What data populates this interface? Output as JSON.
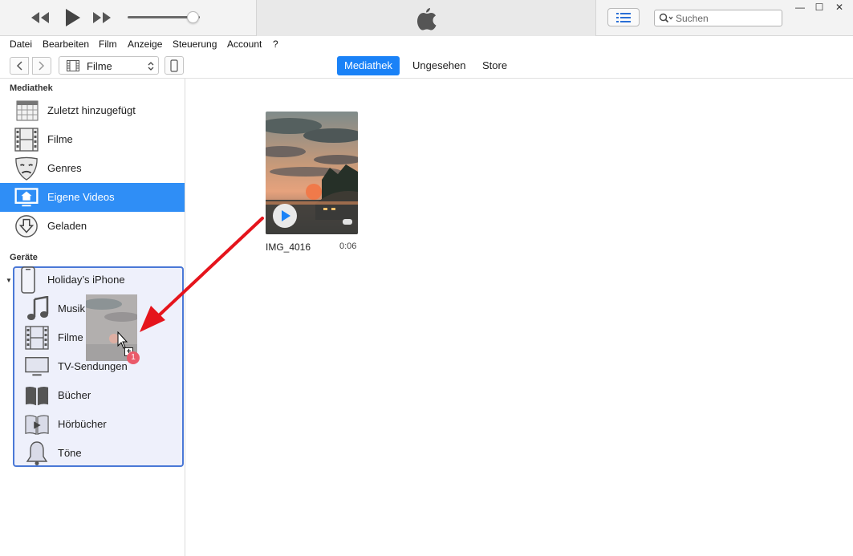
{
  "window": {
    "minimize_glyph": "—",
    "maximize_glyph": "☐",
    "close_glyph": "✕"
  },
  "player": {
    "volume_level": 0.9,
    "search_placeholder": "Suchen"
  },
  "menubar": [
    "Datei",
    "Bearbeiten",
    "Film",
    "Anzeige",
    "Steuerung",
    "Account",
    "?"
  ],
  "nav": {
    "media_kind": "Filme",
    "tabs": [
      "Mediathek",
      "Ungesehen",
      "Store"
    ],
    "active_tab": "Mediathek"
  },
  "sidebar": {
    "library_title": "Mediathek",
    "library_items": [
      {
        "label": "Zuletzt hinzugefügt",
        "icon": "calendar-grid-icon"
      },
      {
        "label": "Filme",
        "icon": "film-strip-icon"
      },
      {
        "label": "Genres",
        "icon": "theater-masks-icon"
      },
      {
        "label": "Eigene Videos",
        "icon": "home-video-icon",
        "selected": true
      },
      {
        "label": "Geladen",
        "icon": "download-circle-icon"
      }
    ],
    "devices_title": "Geräte",
    "device_name": "Holiday’s iPhone",
    "device_items": [
      {
        "label": "Musik",
        "icon": "music-note-icon"
      },
      {
        "label": "Filme",
        "icon": "film-strip-icon"
      },
      {
        "label": "TV-Sendungen",
        "icon": "tv-icon"
      },
      {
        "label": "Bücher",
        "icon": "book-icon"
      },
      {
        "label": "Hörbücher",
        "icon": "audiobook-icon"
      },
      {
        "label": "Töne",
        "icon": "bell-icon"
      }
    ]
  },
  "content": {
    "video": {
      "title": "IMG_4016",
      "duration": "0:06"
    }
  },
  "drag": {
    "count": "1",
    "plus": "+"
  },
  "colors": {
    "accent": "#1a82f7",
    "selected_row": "#2f8ef6",
    "device_box_border": "#4a78d6",
    "arrow": "#e5141c"
  }
}
